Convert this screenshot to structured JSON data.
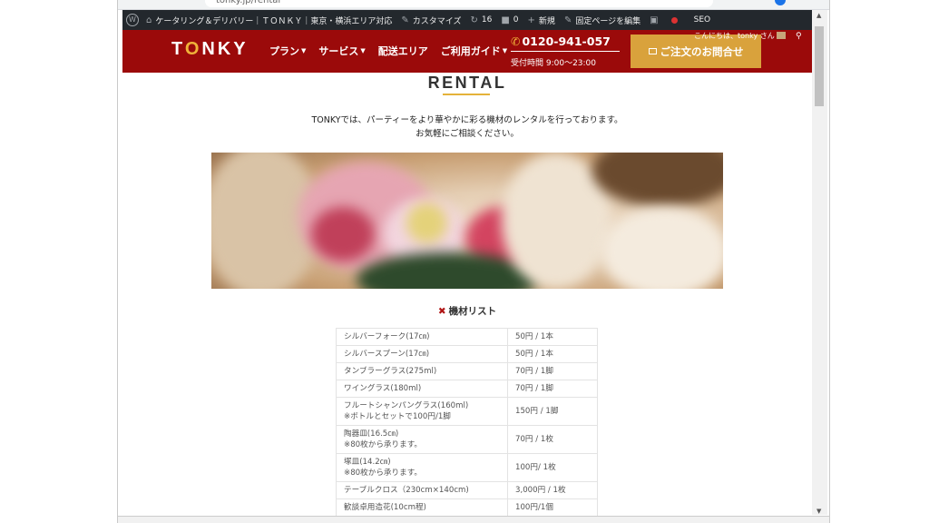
{
  "browser": {
    "url": "tonky.jp/rental"
  },
  "adminbar": {
    "site_name": "ケータリング＆デリバリー｜ＴＯＮＫＹ｜東京・横浜エリア対応",
    "customize": "カスタマイズ",
    "updates": "16",
    "comments": "0",
    "new": "新規",
    "edit": "固定ページを編集",
    "seo": "SEO"
  },
  "header": {
    "logo_pre": "T",
    "logo_o": "O",
    "logo_post": "NKY",
    "nav": [
      {
        "label": "プラン"
      },
      {
        "label": "サービス"
      },
      {
        "label": "配送エリア"
      },
      {
        "label": "ご利用ガイド"
      }
    ],
    "phone": "0120-941-057",
    "hours": "受付時間 9:00〜23:00",
    "greeting": "こんにちは、tonky さん",
    "order_button": "ご注文のお問合せ"
  },
  "main": {
    "title": "RENTAL",
    "intro_line1": "TONKYでは、パーティーをより華やかに彩る機材のレンタルを行っております。",
    "intro_line2": "お気軽にご相談ください。",
    "list_heading": "機材リスト",
    "table": [
      {
        "name": "シルバーフォーク(17㎝)",
        "note": "",
        "price": "50円 / 1本"
      },
      {
        "name": "シルバースプーン(17㎝)",
        "note": "",
        "price": "50円 / 1本"
      },
      {
        "name": "タンブラーグラス(275ml)",
        "note": "",
        "price": "70円 / 1脚"
      },
      {
        "name": "ワイングラス(180ml)",
        "note": "",
        "price": "70円 / 1脚"
      },
      {
        "name": "フルートシャンパングラス(160ml)",
        "note": "※ボトルとセットで100円/1脚",
        "price": "150円 / 1脚"
      },
      {
        "name": "陶器皿(16.5㎝)",
        "note": "※80枚から承ります。",
        "price": "70円 / 1枚"
      },
      {
        "name": "塚皿(14.2㎝)",
        "note": "※80枚から承ります。",
        "price": "100円/ 1枚"
      },
      {
        "name": "テーブルクロス（230cm×140cm)",
        "note": "",
        "price": "3,000円 / 1枚"
      },
      {
        "name": "歓談卓用造花(10cm程)",
        "note": "",
        "price": "100円/1個"
      }
    ]
  },
  "colors": {
    "header_bg": "#9b0a0a",
    "accent": "#d9a23c",
    "adminbar_bg": "#23282d"
  }
}
